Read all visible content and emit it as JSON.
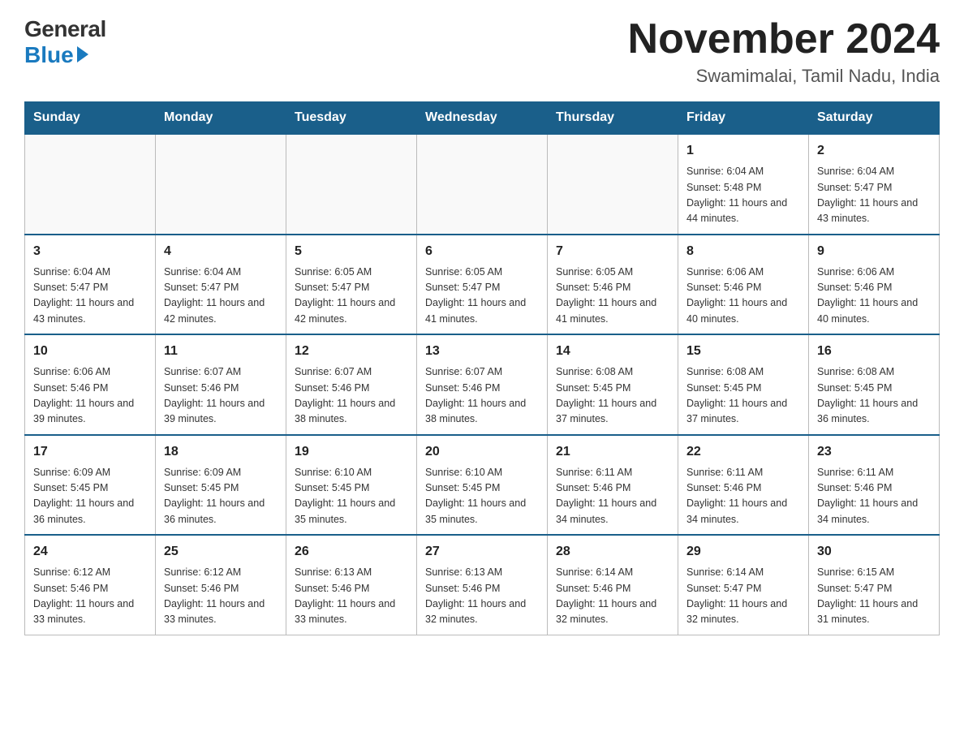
{
  "logo": {
    "general": "General",
    "blue": "Blue"
  },
  "title": "November 2024",
  "subtitle": "Swamimalai, Tamil Nadu, India",
  "days_of_week": [
    "Sunday",
    "Monday",
    "Tuesday",
    "Wednesday",
    "Thursday",
    "Friday",
    "Saturday"
  ],
  "weeks": [
    [
      {
        "day": "",
        "info": ""
      },
      {
        "day": "",
        "info": ""
      },
      {
        "day": "",
        "info": ""
      },
      {
        "day": "",
        "info": ""
      },
      {
        "day": "",
        "info": ""
      },
      {
        "day": "1",
        "info": "Sunrise: 6:04 AM\nSunset: 5:48 PM\nDaylight: 11 hours and 44 minutes."
      },
      {
        "day": "2",
        "info": "Sunrise: 6:04 AM\nSunset: 5:47 PM\nDaylight: 11 hours and 43 minutes."
      }
    ],
    [
      {
        "day": "3",
        "info": "Sunrise: 6:04 AM\nSunset: 5:47 PM\nDaylight: 11 hours and 43 minutes."
      },
      {
        "day": "4",
        "info": "Sunrise: 6:04 AM\nSunset: 5:47 PM\nDaylight: 11 hours and 42 minutes."
      },
      {
        "day": "5",
        "info": "Sunrise: 6:05 AM\nSunset: 5:47 PM\nDaylight: 11 hours and 42 minutes."
      },
      {
        "day": "6",
        "info": "Sunrise: 6:05 AM\nSunset: 5:47 PM\nDaylight: 11 hours and 41 minutes."
      },
      {
        "day": "7",
        "info": "Sunrise: 6:05 AM\nSunset: 5:46 PM\nDaylight: 11 hours and 41 minutes."
      },
      {
        "day": "8",
        "info": "Sunrise: 6:06 AM\nSunset: 5:46 PM\nDaylight: 11 hours and 40 minutes."
      },
      {
        "day": "9",
        "info": "Sunrise: 6:06 AM\nSunset: 5:46 PM\nDaylight: 11 hours and 40 minutes."
      }
    ],
    [
      {
        "day": "10",
        "info": "Sunrise: 6:06 AM\nSunset: 5:46 PM\nDaylight: 11 hours and 39 minutes."
      },
      {
        "day": "11",
        "info": "Sunrise: 6:07 AM\nSunset: 5:46 PM\nDaylight: 11 hours and 39 minutes."
      },
      {
        "day": "12",
        "info": "Sunrise: 6:07 AM\nSunset: 5:46 PM\nDaylight: 11 hours and 38 minutes."
      },
      {
        "day": "13",
        "info": "Sunrise: 6:07 AM\nSunset: 5:46 PM\nDaylight: 11 hours and 38 minutes."
      },
      {
        "day": "14",
        "info": "Sunrise: 6:08 AM\nSunset: 5:45 PM\nDaylight: 11 hours and 37 minutes."
      },
      {
        "day": "15",
        "info": "Sunrise: 6:08 AM\nSunset: 5:45 PM\nDaylight: 11 hours and 37 minutes."
      },
      {
        "day": "16",
        "info": "Sunrise: 6:08 AM\nSunset: 5:45 PM\nDaylight: 11 hours and 36 minutes."
      }
    ],
    [
      {
        "day": "17",
        "info": "Sunrise: 6:09 AM\nSunset: 5:45 PM\nDaylight: 11 hours and 36 minutes."
      },
      {
        "day": "18",
        "info": "Sunrise: 6:09 AM\nSunset: 5:45 PM\nDaylight: 11 hours and 36 minutes."
      },
      {
        "day": "19",
        "info": "Sunrise: 6:10 AM\nSunset: 5:45 PM\nDaylight: 11 hours and 35 minutes."
      },
      {
        "day": "20",
        "info": "Sunrise: 6:10 AM\nSunset: 5:45 PM\nDaylight: 11 hours and 35 minutes."
      },
      {
        "day": "21",
        "info": "Sunrise: 6:11 AM\nSunset: 5:46 PM\nDaylight: 11 hours and 34 minutes."
      },
      {
        "day": "22",
        "info": "Sunrise: 6:11 AM\nSunset: 5:46 PM\nDaylight: 11 hours and 34 minutes."
      },
      {
        "day": "23",
        "info": "Sunrise: 6:11 AM\nSunset: 5:46 PM\nDaylight: 11 hours and 34 minutes."
      }
    ],
    [
      {
        "day": "24",
        "info": "Sunrise: 6:12 AM\nSunset: 5:46 PM\nDaylight: 11 hours and 33 minutes."
      },
      {
        "day": "25",
        "info": "Sunrise: 6:12 AM\nSunset: 5:46 PM\nDaylight: 11 hours and 33 minutes."
      },
      {
        "day": "26",
        "info": "Sunrise: 6:13 AM\nSunset: 5:46 PM\nDaylight: 11 hours and 33 minutes."
      },
      {
        "day": "27",
        "info": "Sunrise: 6:13 AM\nSunset: 5:46 PM\nDaylight: 11 hours and 32 minutes."
      },
      {
        "day": "28",
        "info": "Sunrise: 6:14 AM\nSunset: 5:46 PM\nDaylight: 11 hours and 32 minutes."
      },
      {
        "day": "29",
        "info": "Sunrise: 6:14 AM\nSunset: 5:47 PM\nDaylight: 11 hours and 32 minutes."
      },
      {
        "day": "30",
        "info": "Sunrise: 6:15 AM\nSunset: 5:47 PM\nDaylight: 11 hours and 31 minutes."
      }
    ]
  ]
}
